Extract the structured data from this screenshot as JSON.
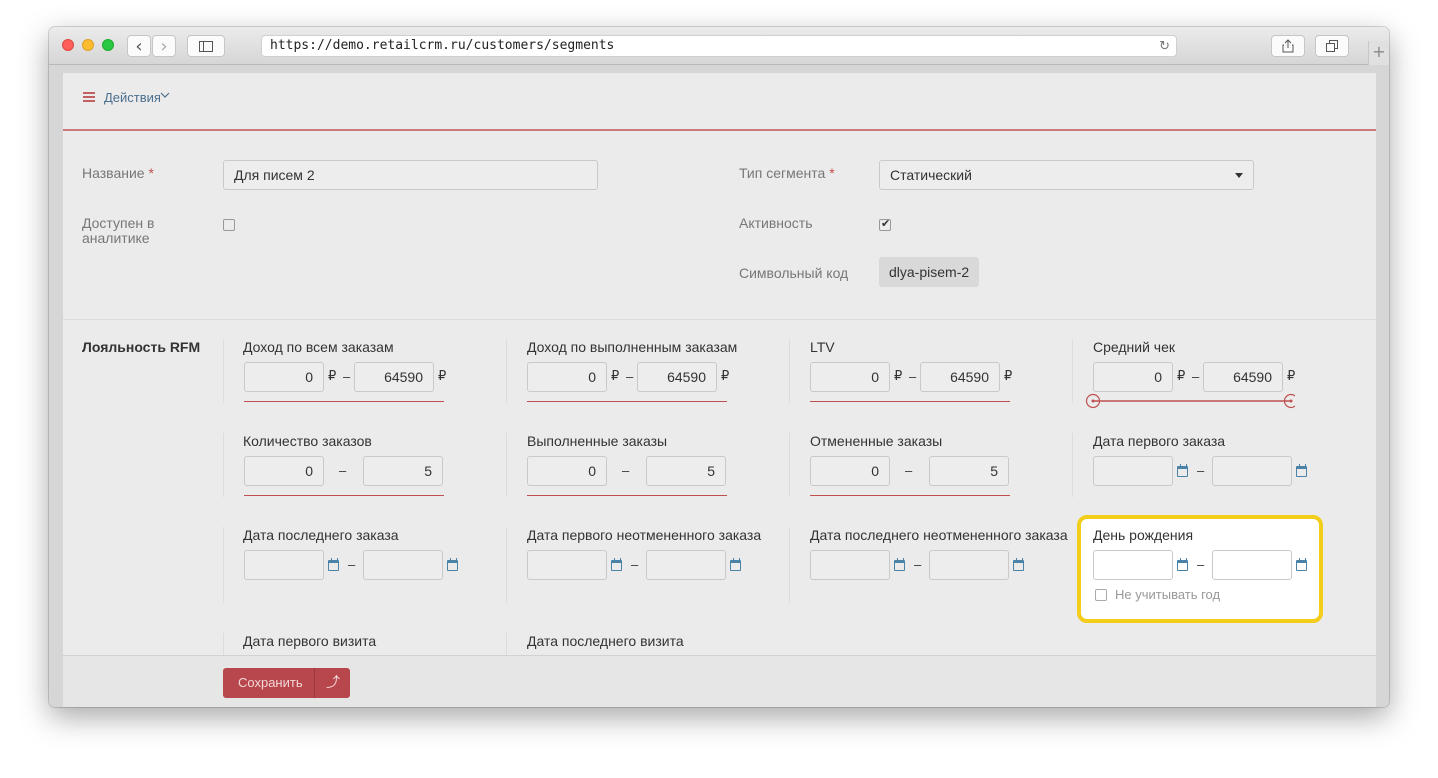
{
  "browser": {
    "url": "https://demo.retailcrm.ru/customers/segments",
    "back": "‹",
    "forward": "›",
    "reload": "↻",
    "new_tab": "+"
  },
  "toolbar": {
    "actions_label": "Действия"
  },
  "form": {
    "name_label": "Название",
    "required_mark": "*",
    "name_value": "Для писем 2",
    "analytics_label_1": "Доступен в",
    "analytics_label_2": "аналитике",
    "analytics_checked": false,
    "segment_type_label": "Тип сегмента",
    "segment_type_value": "Статический",
    "active_label": "Активность",
    "active_checked": true,
    "code_label": "Символьный код",
    "code_value": "dlya-pisem-2"
  },
  "rfm": {
    "title": "Лояльность RFM",
    "currency": "₽",
    "dash": "–",
    "income_all": {
      "label": "Доход по всем заказам",
      "from": "0",
      "to": "64590"
    },
    "income_done": {
      "label": "Доход по выполненным заказам",
      "from": "0",
      "to": "64590"
    },
    "ltv": {
      "label": "LTV",
      "from": "0",
      "to": "64590"
    },
    "avg_check": {
      "label": "Средний чек",
      "from": "0",
      "to": "64590"
    },
    "orders_count": {
      "label": "Количество заказов",
      "from": "0",
      "to": "5"
    },
    "orders_done": {
      "label": "Выполненные заказы",
      "from": "0",
      "to": "5"
    },
    "orders_cancelled": {
      "label": "Отмененные заказы",
      "from": "0",
      "to": "5"
    },
    "first_order_date": {
      "label": "Дата первого заказа"
    },
    "last_order_date": {
      "label": "Дата последнего заказа"
    },
    "first_uncancelled_date": {
      "label": "Дата первого неотмененного заказа"
    },
    "last_uncancelled_date": {
      "label": "Дата последнего неотмененного заказа"
    },
    "birthday": {
      "label": "День рождения",
      "ignore_year_label": "Не учитывать год",
      "ignore_year_checked": false
    },
    "first_visit_date": {
      "label": "Дата первого визита"
    },
    "last_visit_date": {
      "label": "Дата последнего визита"
    }
  },
  "footer": {
    "save_label": "Сохранить",
    "up_label": "⤴"
  },
  "colors": {
    "accent": "#c05050",
    "highlight": "#f2cd1a",
    "link": "#4b6f8e"
  }
}
